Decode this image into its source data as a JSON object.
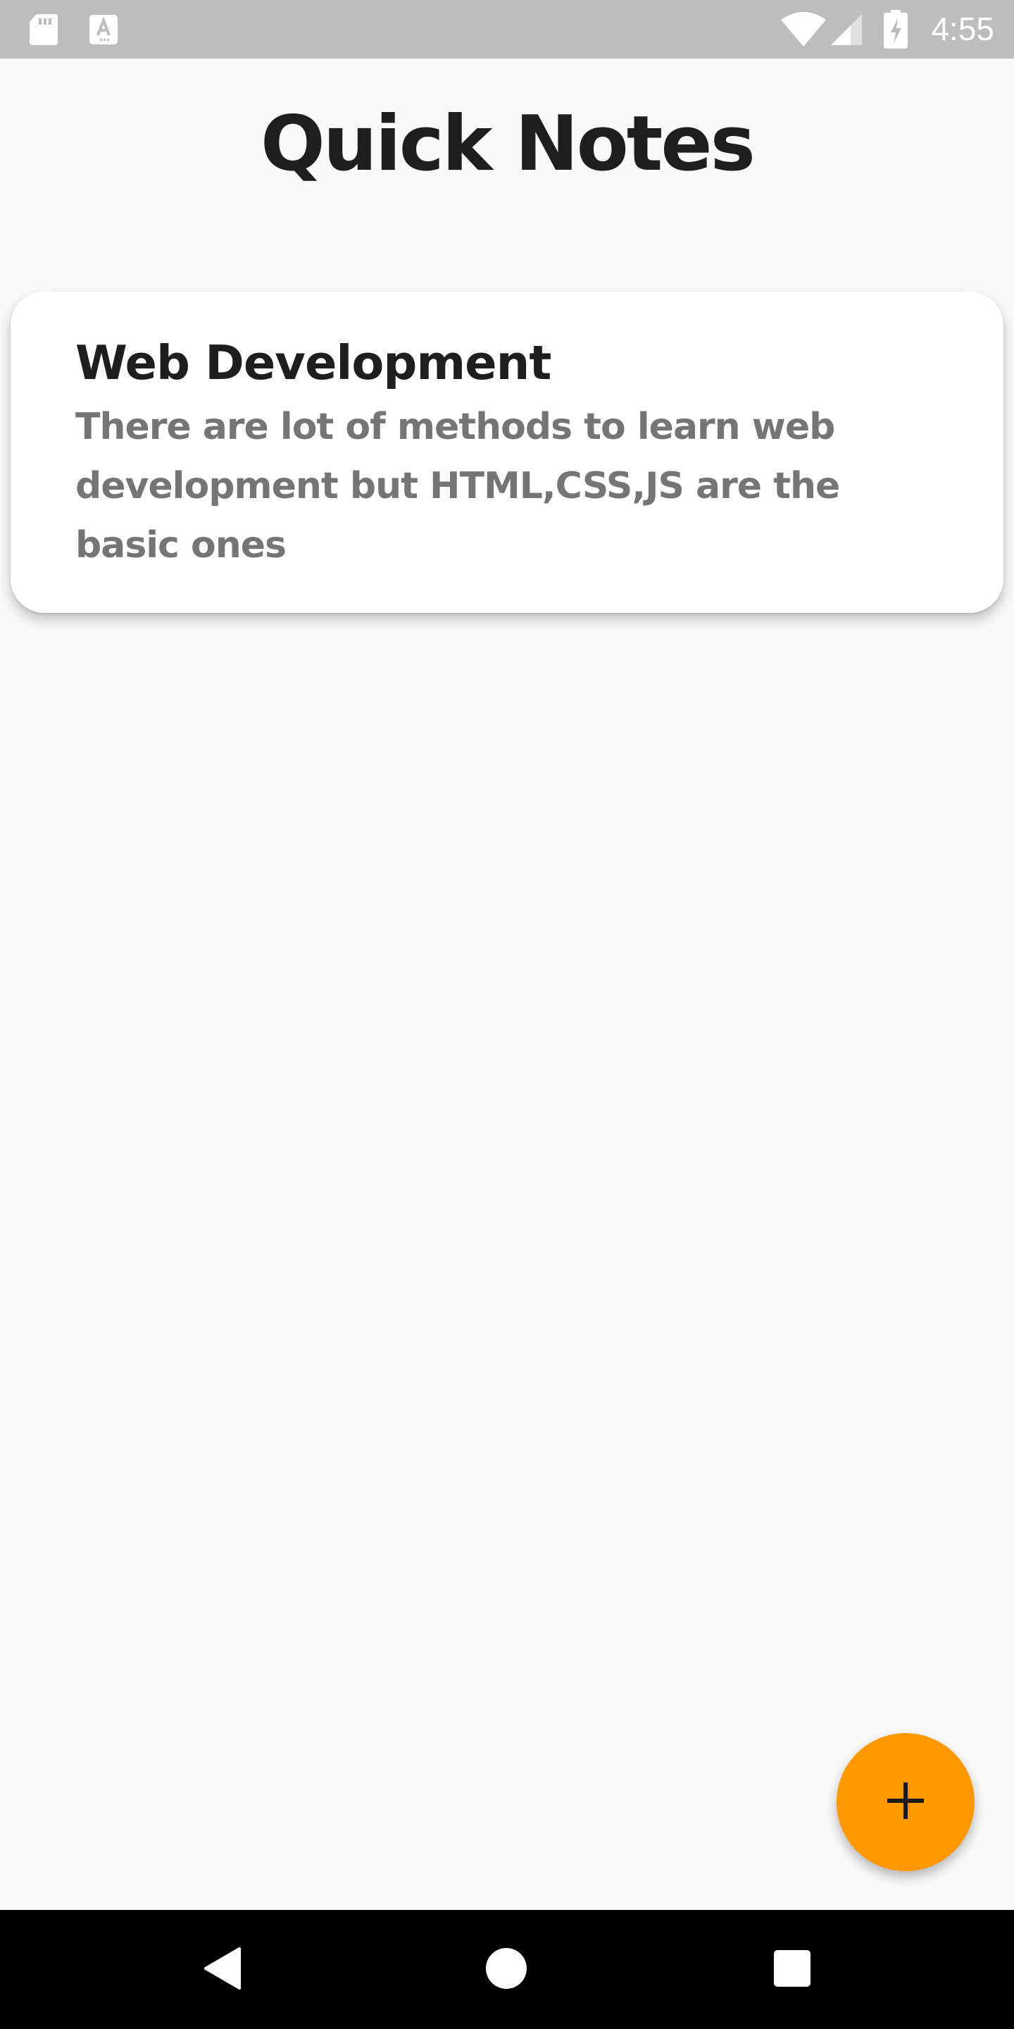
{
  "status_bar": {
    "time": "4:55",
    "icons": [
      "sd-card-icon",
      "keyboard-a-icon",
      "wifi-icon",
      "signal-icon",
      "battery-charging-icon"
    ],
    "background": "#bdbdbd"
  },
  "app": {
    "title": "Quick Notes"
  },
  "notes": [
    {
      "title": "Web Development",
      "body": "There are lot of methods to learn web development but HTML,CSS,JS are the basic ones"
    }
  ],
  "fab": {
    "icon": "plus-icon",
    "color": "#ff9800"
  },
  "nav_bar": {
    "buttons": [
      "back-icon",
      "home-icon",
      "recents-icon"
    ]
  }
}
